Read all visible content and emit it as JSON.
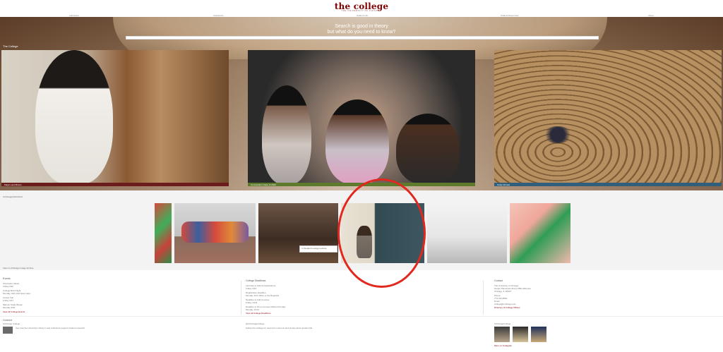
{
  "header": {
    "logo": "the college",
    "logo_sub": "THE UNIVERSITY OF CHICAGO",
    "nav": [
      "Admission",
      "Academics",
      "Student Life",
      "Student Resources",
      "About"
    ]
  },
  "hero": {
    "quote_line_1": "Search is good in theory",
    "quote_line_2": "but what do you need to know?",
    "search_placeholder": "",
    "section_label": "The College",
    "tiles": [
      {
        "caption": "Majors and Minors"
      },
      {
        "caption": "Convocation Class of 2023"
      },
      {
        "caption": "Study Abroad"
      }
    ]
  },
  "gallery": {
    "label": "UChicago|CHICAGO",
    "banner_caption": "In Student Lounge Lecture",
    "link": "View in UChicago Image Archive",
    "thumbnails": [
      "thumb-mural",
      "thumb-group-photo",
      "thumb-reception",
      "thumb-chalkboard-lecture",
      "thumb-classroom",
      "thumb-art-mural"
    ]
  },
  "footer": {
    "col1": {
      "heading": "Events",
      "lines": [
        "Orientation Week",
        "Friday 9/20",
        "College Bowl Night",
        "Monday, 9/23 Hull Gate Lawn",
        "Career Fair",
        "Friday 9/27",
        "Maroon Study Break",
        "Monday 9/30",
        "View all College Events"
      ]
    },
    "col2": {
      "heading": "College Deadlines",
      "lines": [
        "Last Day to Submit Applications",
        "Friday 10/4",
        "Registration Deadline",
        "Monday 10/7 Office of the Registrar",
        "Deadline to Add Courses",
        "Friday 10/11",
        "Deadline to Drop Courses Without Penalty",
        "Monday 10/14",
        "View all College Deadlines"
      ]
    },
    "col3": {
      "heading": "Contact",
      "lines": [
        "The University of Chicago",
        "Harper Memorial Library 5801 Ellis Ave",
        "Chicago, IL 60637",
        "Phone",
        "773.702.8650",
        "Email",
        "college@uchicago.edu",
        "Directory of College Offices"
      ]
    },
    "bottom": {
      "heading": "Connect",
      "social_1": "UChicago College",
      "social_1_text": "See how the University Library's vast collections support student research",
      "social_2": "@UChicagoCollege",
      "social_2_text": "Follow the College for news from campus and stories about student life.",
      "social_3": "UChicagoCollege",
      "more_link": "More on Instagram"
    }
  },
  "colors": {
    "brand": "#800000",
    "annotation": "#e0281f"
  }
}
